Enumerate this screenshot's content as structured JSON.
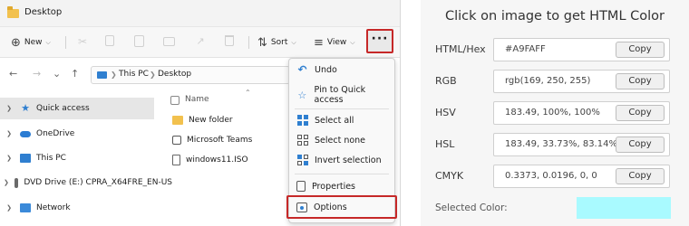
{
  "explorer": {
    "window_title": "Desktop",
    "toolbar": {
      "new_label": "New",
      "sort_label": "Sort",
      "view_label": "View",
      "more_label": "···"
    },
    "address": {
      "this_pc": "This PC",
      "desktop": "Desktop"
    },
    "nav_pane": [
      {
        "label": "Quick access",
        "icon": "star-icon"
      },
      {
        "label": "OneDrive",
        "icon": "cloud-icon"
      },
      {
        "label": "This PC",
        "icon": "pc-icon"
      },
      {
        "label": "DVD Drive (E:) CPRA_X64FRE_EN-US",
        "icon": "dvd-icon"
      },
      {
        "label": "Network",
        "icon": "network-icon"
      }
    ],
    "column_header": "Name",
    "files": [
      {
        "name": "New folder",
        "icon": "folder-icon"
      },
      {
        "name": "Microsoft Teams",
        "icon": "teams-icon"
      },
      {
        "name": "windows11.ISO",
        "icon": "iso-file-icon"
      }
    ],
    "context_menu": [
      {
        "label": "Undo",
        "icon": "undo-icon"
      },
      {
        "label": "Pin to Quick access",
        "icon": "pin-icon"
      },
      {
        "label": "Select all",
        "icon": "select-all-icon"
      },
      {
        "label": "Select none",
        "icon": "select-none-icon"
      },
      {
        "label": "Invert selection",
        "icon": "invert-selection-icon"
      },
      {
        "label": "Properties",
        "icon": "properties-icon"
      },
      {
        "label": "Options",
        "icon": "options-icon"
      }
    ],
    "highlight_color": "#c62828"
  },
  "picker": {
    "title": "Click on image to get HTML Color",
    "rows": [
      {
        "label": "HTML/Hex",
        "value": "#A9FAFF",
        "copy": "Copy"
      },
      {
        "label": "RGB",
        "value": "rgb(169, 250, 255)",
        "copy": "Copy"
      },
      {
        "label": "HSV",
        "value": "183.49, 100%, 100%",
        "copy": "Copy"
      },
      {
        "label": "HSL",
        "value": "183.49, 33.73%, 83.14%",
        "copy": "Copy"
      },
      {
        "label": "CMYK",
        "value": "0.3373, 0.0196, 0, 0",
        "copy": "Copy"
      }
    ],
    "selected_label": "Selected Color:",
    "selected_color": "#A9FAFF"
  }
}
